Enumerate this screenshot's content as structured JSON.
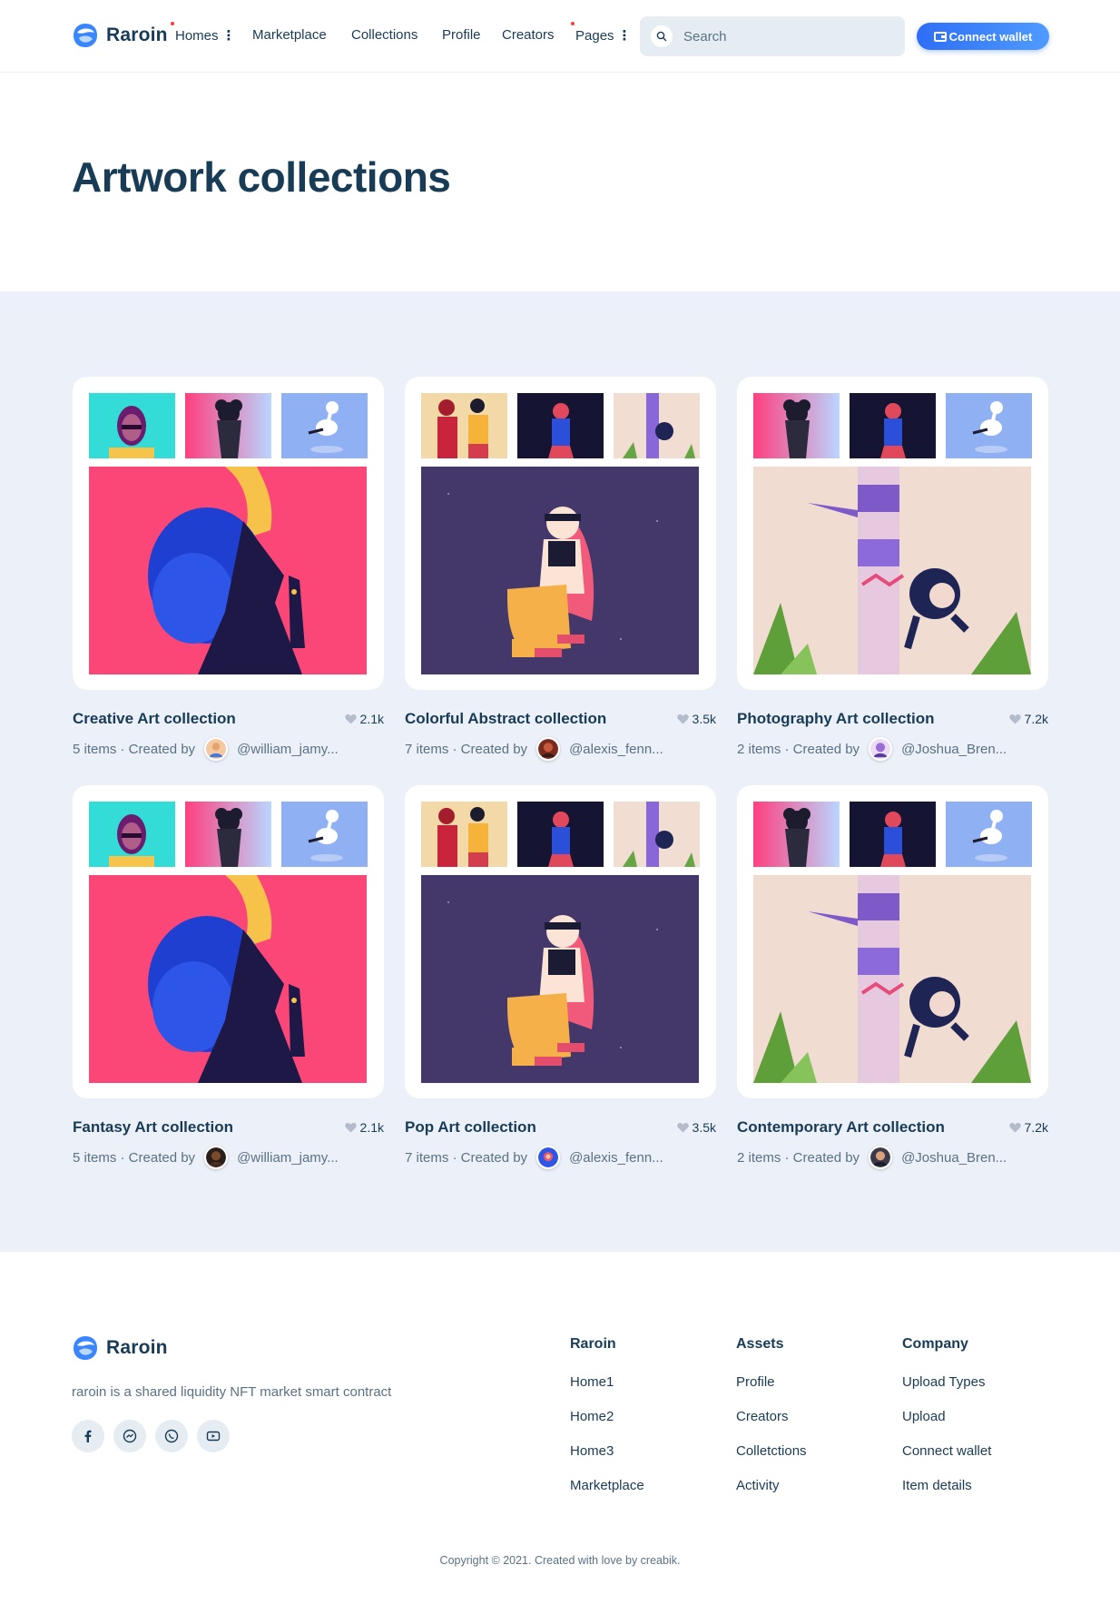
{
  "brand": {
    "name": "Raroin",
    "accent": "#2e6ef7"
  },
  "nav": {
    "items": [
      {
        "label": "Homes",
        "dot": true,
        "kebab": true
      },
      {
        "label": "Marketplace",
        "dot": false,
        "kebab": false
      },
      {
        "label": "Collections",
        "dot": false,
        "kebab": false
      },
      {
        "label": "Profile",
        "dot": false,
        "kebab": false
      },
      {
        "label": "Creators",
        "dot": false,
        "kebab": false
      },
      {
        "label": "Pages",
        "dot": true,
        "kebab": true
      }
    ]
  },
  "search": {
    "placeholder": "Search",
    "value": ""
  },
  "connect_wallet_label": "Connect wallet",
  "page_title": "Artwork collections",
  "collections": [
    {
      "title": "Creative Art collection",
      "likes": "2.1k",
      "items": "5 items · Created by",
      "creator": "@william_jamy..."
    },
    {
      "title": "Colorful Abstract collection",
      "likes": "3.5k",
      "items": "7 items · Created by",
      "creator": "@alexis_fenn..."
    },
    {
      "title": "Photography Art collection",
      "likes": "7.2k",
      "items": "2 items · Created by",
      "creator": "@Joshua_Bren..."
    },
    {
      "title": "Fantasy Art collection",
      "likes": "2.1k",
      "items": "5 items · Created by",
      "creator": "@william_jamy..."
    },
    {
      "title": "Pop Art collection",
      "likes": "3.5k",
      "items": "7 items · Created by",
      "creator": "@alexis_fenn..."
    },
    {
      "title": "Contemporary Art collection",
      "likes": "7.2k",
      "items": "2 items · Created by",
      "creator": "@Joshua_Bren..."
    }
  ],
  "footer": {
    "brand": "Raroin",
    "description": "raroin is a shared liquidity NFT market smart contract",
    "socials": [
      "facebook-icon",
      "messenger-icon",
      "whatsapp-icon",
      "youtube-icon"
    ],
    "columns": [
      {
        "title": "Raroin",
        "links": [
          "Home1",
          "Home2",
          "Home3",
          "Marketplace"
        ]
      },
      {
        "title": "Assets",
        "links": [
          "Profile",
          "Creators",
          "Colletctions",
          "Activity"
        ]
      },
      {
        "title": "Company",
        "links": [
          "Upload Types",
          "Upload",
          "Connect wallet",
          "Item details"
        ]
      }
    ],
    "copyright": "Copyright © 2021. Created with love by creabik."
  }
}
